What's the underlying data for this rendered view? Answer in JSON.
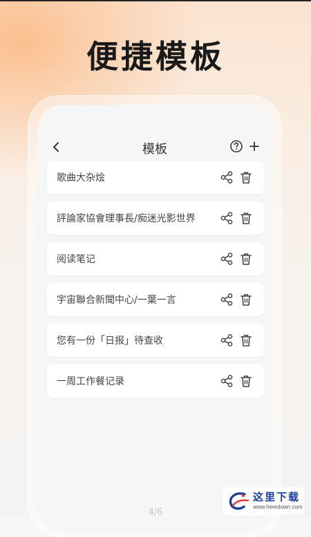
{
  "headline": "便捷模板",
  "app": {
    "title": "模板",
    "back_icon": "chevron-left-icon",
    "help_icon": "question-circle-icon",
    "add_icon": "plus-icon"
  },
  "templates": [
    {
      "label": "歌曲大杂烩"
    },
    {
      "label": "評論家協會理事長/痴迷光影世界"
    },
    {
      "label": "阅读笔记"
    },
    {
      "label": "宇宙聯合新聞中心/一葉一言"
    },
    {
      "label": "您有一份「日报」待查收"
    },
    {
      "label": "一周工作餐记录"
    }
  ],
  "card_actions": {
    "share_icon": "share-icon",
    "delete_icon": "trash-icon"
  },
  "page_indicator": "4/6",
  "watermark": {
    "text": "这里下载",
    "url": "www.heredown.com"
  },
  "colors": {
    "accent_orange": "#fbbf8e",
    "text": "#333333",
    "card_bg": "#ffffff",
    "watermark_blue": "#1d3e9a"
  }
}
